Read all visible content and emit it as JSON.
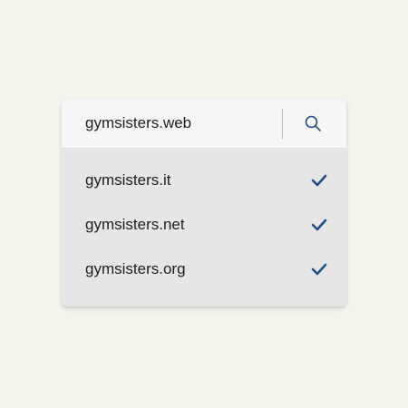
{
  "search": {
    "value": "gymsisters.web",
    "button_icon": "search-icon"
  },
  "results": [
    {
      "domain": "gymsisters.it",
      "status_icon": "checkmark-icon"
    },
    {
      "domain": "gymsisters.net",
      "status_icon": "checkmark-icon"
    },
    {
      "domain": "gymsisters.org",
      "status_icon": "checkmark-icon"
    }
  ],
  "colors": {
    "accent": "#1f4e8c",
    "background": "#f5f4ed",
    "panel": "#e6e6e6",
    "search_bar": "#f6f6f6"
  }
}
